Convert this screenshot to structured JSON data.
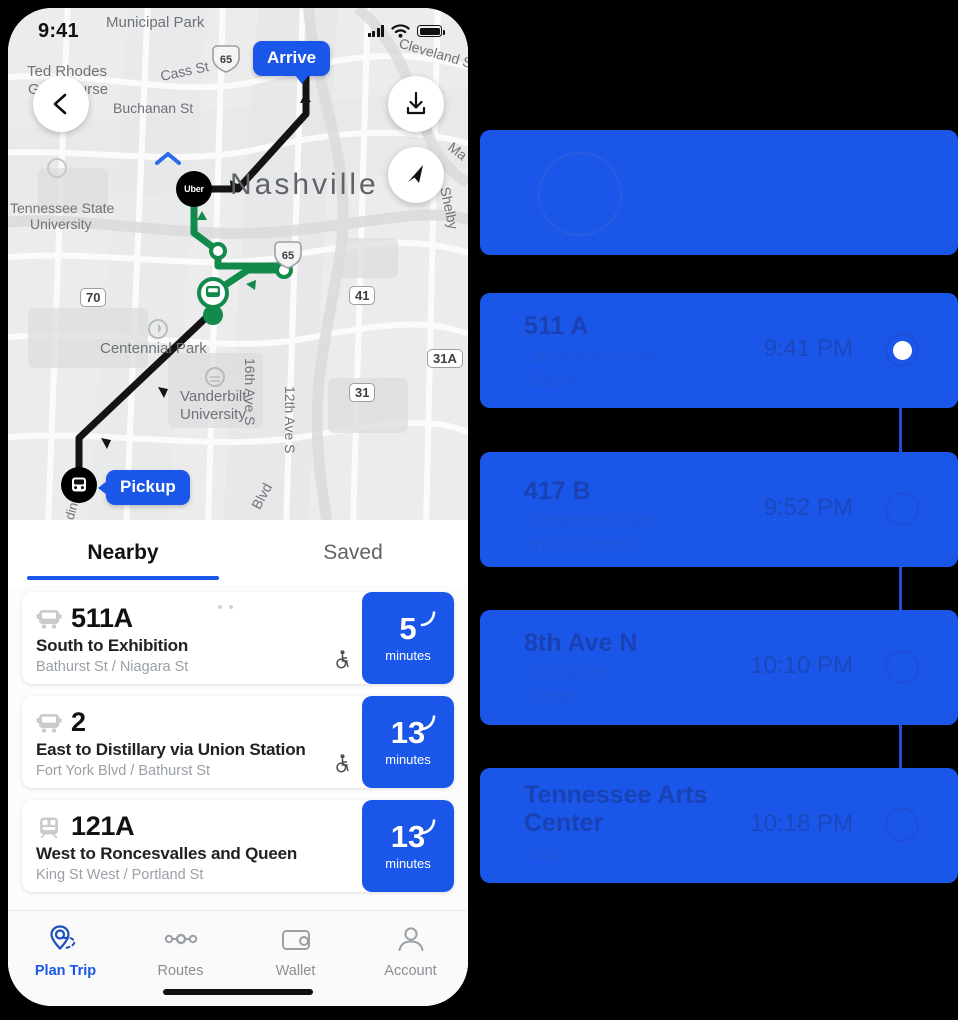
{
  "phone": {
    "status": {
      "time": "9:41",
      "signal_icon": "cellular-signal-icon",
      "wifi_icon": "wifi-icon",
      "battery_icon": "battery-icon"
    },
    "map": {
      "back_icon": "back-chevron-icon",
      "download_icon": "download-icon",
      "locate_icon": "navigation-arrow-icon",
      "arrive_label": "Arrive",
      "pickup_label": "Pickup",
      "uber_node_label": "Uber",
      "city_label": "Nashville",
      "labels": [
        "Municipal Park",
        "Ted Rhodes",
        "Golf Course",
        "Cass St",
        "Buchanan St",
        "Cleveland S",
        "Tennessee State",
        "University",
        "Centennial Park",
        "Vanderbilt",
        "University",
        "16th Ave S",
        "12th Ave S",
        "Shelby",
        "Ma",
        "Blvd",
        "ding"
      ],
      "shields": [
        "70",
        "41",
        "31A",
        "31"
      ],
      "interstate_shield": "65"
    },
    "tabs": [
      {
        "label": "Nearby",
        "active": true
      },
      {
        "label": "Saved",
        "active": false
      }
    ],
    "routes": [
      {
        "icon": "bus-icon",
        "number": "511A",
        "destination": "South to Exhibition",
        "stop": "Bathurst St / Niagara St",
        "accessible_icon": "wheelchair-accessible-icon",
        "minutes": "5",
        "minutes_unit": "minutes",
        "live_icon": "live-signal-icon"
      },
      {
        "icon": "bus-icon",
        "number": "2",
        "destination": "East to Distillary via Union Station",
        "stop": "Fort York Blvd / Bathurst St",
        "accessible_icon": "wheelchair-accessible-icon",
        "minutes": "13",
        "minutes_unit": "minutes",
        "live_icon": "live-signal-icon"
      },
      {
        "icon": "train-icon",
        "number": "121A",
        "destination": "West to Roncesvalles and Queen",
        "stop": "King St West / Portland St",
        "accessible_icon": "",
        "minutes": "13",
        "minutes_unit": "minutes",
        "live_icon": "live-signal-icon"
      }
    ],
    "nav": [
      {
        "label": "Plan Trip",
        "icon": "map-pin-route-icon",
        "active": true
      },
      {
        "label": "Routes",
        "icon": "route-nodes-icon",
        "active": false
      },
      {
        "label": "Wallet",
        "icon": "wallet-icon",
        "active": false
      },
      {
        "label": "Account",
        "icon": "person-icon",
        "active": false
      }
    ]
  },
  "timeline": {
    "hero": {
      "icon": "circle-outline-icon"
    },
    "stops": [
      {
        "title": "511 A",
        "subtitle": "Centennial Park\nStation",
        "time": "9:41 PM",
        "state": "current"
      },
      {
        "title": "417 B",
        "subtitle": "Broadway West\nand Elliston Pl",
        "time": "9:52 PM",
        "state": "upcoming"
      },
      {
        "title": "8th Ave N",
        "subtitle": "at Division\nStreet",
        "time": "10:10 PM",
        "state": "upcoming"
      },
      {
        "title": "Tennessee Arts Center",
        "subtitle": "Stop",
        "time": "10:18 PM",
        "state": "upcoming"
      }
    ]
  },
  "colors": {
    "accent": "#1a56e8",
    "map_bg": "#eceded",
    "badge": "#1a56e8"
  }
}
